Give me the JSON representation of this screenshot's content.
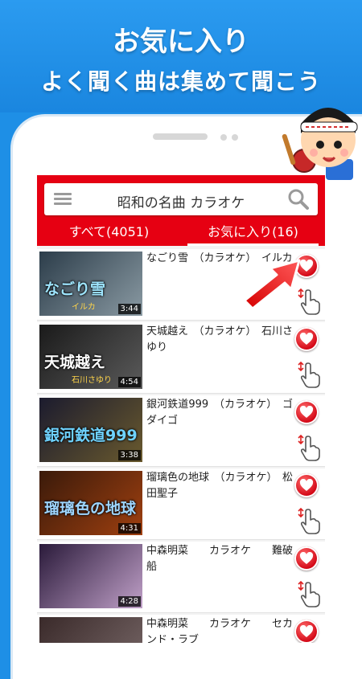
{
  "promo": {
    "headline": "お気に入り",
    "subheadline": "よく聞く曲は集めて聞こう"
  },
  "app": {
    "title": "昭和の名曲 カラオケ",
    "tabs": [
      {
        "label": "すべて(4051)",
        "active": false
      },
      {
        "label": "お気に入り(16)",
        "active": true
      }
    ],
    "accent_color": "#e60012"
  },
  "songs": [
    {
      "title": "なごり雪　（カラオケ）　イルカ",
      "duration": "3:44",
      "thumb_text": "なごり雪",
      "thumb_sub": "イルカ",
      "thumb_colors": [
        "#2c3d4a",
        "#8a9aa3"
      ],
      "caption_color": "#9fe6ff"
    },
    {
      "title": "天城越え　（カラオケ）　石川さゆり",
      "duration": "4:54",
      "thumb_text": "天城越え",
      "thumb_sub": "石川さゆり",
      "thumb_colors": [
        "#1a1a1a",
        "#5b5b5b"
      ],
      "caption_color": "#ffffff"
    },
    {
      "title": "銀河鉄道999　（カラオケ）　ゴダイゴ",
      "duration": "3:38",
      "thumb_text": "銀河鉄道999",
      "thumb_sub": "",
      "thumb_colors": [
        "#1b1b2e",
        "#6a5a2e"
      ],
      "caption_color": "#6fd3ff"
    },
    {
      "title": "瑠璃色の地球　（カラオケ）　松田聖子",
      "duration": "4:31",
      "thumb_text": "瑠璃色の地球",
      "thumb_sub": "",
      "thumb_colors": [
        "#3a1a0a",
        "#a04010"
      ],
      "caption_color": "#9fd6ff"
    },
    {
      "title": "中森明菜　　カラオケ　　難破船",
      "duration": "4:28",
      "thumb_text": "",
      "thumb_sub": "",
      "thumb_colors": [
        "#2a1a3a",
        "#c0a0c8"
      ],
      "caption_color": "#ffffff"
    },
    {
      "title": "中森明菜　　カラオケ　　セカンド・ラブ",
      "duration": "",
      "thumb_text": "",
      "thumb_sub": "",
      "thumb_colors": [
        "#3a2a2a",
        "#7a6a6a"
      ],
      "caption_color": "#ffffff"
    }
  ],
  "icons": {
    "menu": "hamburger-menu-icon",
    "search": "magnifier-icon",
    "favorite": "heart-icon",
    "reorder": "hand-drag-icon",
    "pointer": "red-arrow-icon"
  }
}
